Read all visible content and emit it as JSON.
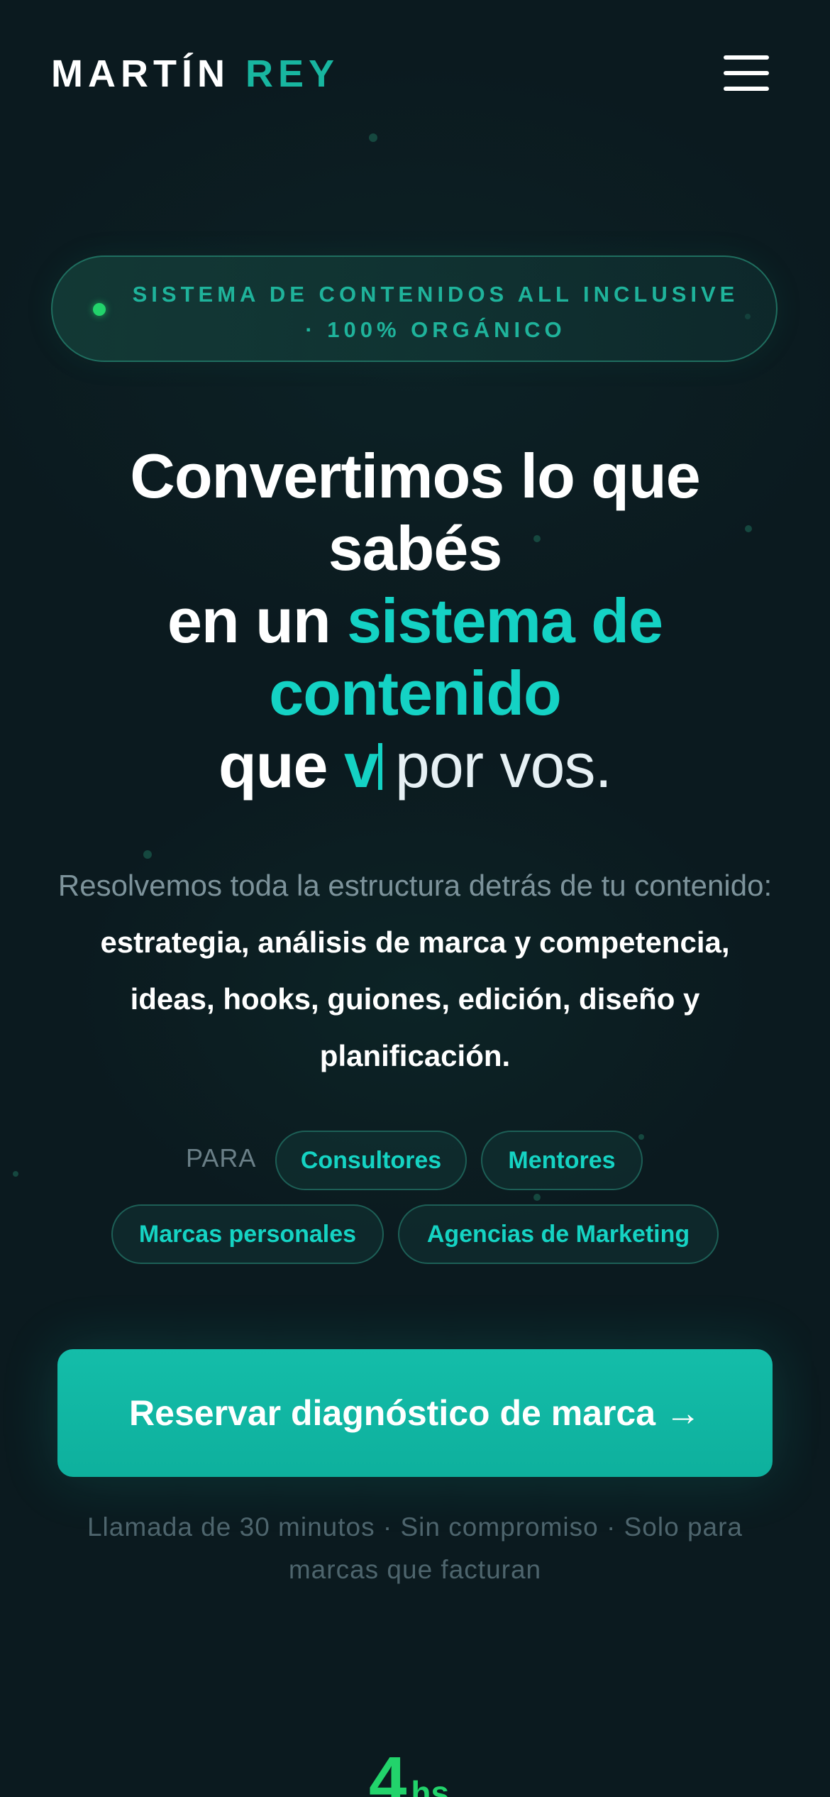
{
  "header": {
    "brand_first": "MARTÍN",
    "brand_last": "REY",
    "menu_icon": "hamburger-menu-icon"
  },
  "badge": {
    "text": "SISTEMA DE CONTENIDOS ALL INCLUSIVE · 100% ORGÁNICO",
    "dot_color": "#22d36b"
  },
  "headline": {
    "line1": "Convertimos lo que sabés",
    "line2_prefix": "en un ",
    "line2_accent": "sistema de contenido",
    "line3_prefix": "que ",
    "line3_typed": "v",
    "line3_tail": "por vos."
  },
  "description": {
    "intro": "Resolvemos toda la estructura detrás de tu contenido: ",
    "highlight": "estrategia, análisis de marca y competencia, ideas, hooks, guiones, edición, diseño y planificación."
  },
  "audience": {
    "label": "PARA",
    "tags": [
      "Consultores",
      "Mentores",
      "Marcas personales",
      "Agencias de Marketing"
    ]
  },
  "cta": {
    "label": "Reservar diagnóstico de marca →",
    "note": "Llamada de 30 minutos · Sin compromiso · Solo para marcas que facturan"
  },
  "stat": {
    "value": "4",
    "unit": "hs"
  },
  "colors": {
    "background": "#0b1a1f",
    "accent": "#14d2c4",
    "cta": "#0eb09d",
    "green": "#22d36b"
  }
}
